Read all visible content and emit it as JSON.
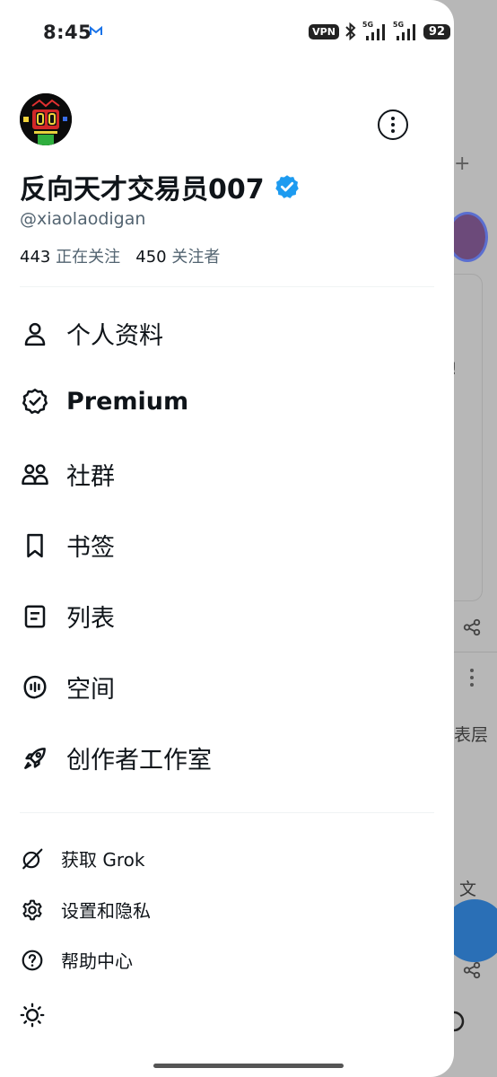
{
  "status_bar": {
    "time": "8:45",
    "vpn": "VPN",
    "signal_1": "5G",
    "signal_2": "5G",
    "battery": "92"
  },
  "profile": {
    "display_name": "反向天才交易员007",
    "handle": "@xiaolaodigan",
    "following_count": "443",
    "following_label": "正在关注",
    "followers_count": "450",
    "followers_label": "关注者",
    "verified_color": "#1d9bf0"
  },
  "menu": {
    "items": [
      {
        "label": "个人资料",
        "icon": "person-icon"
      },
      {
        "label": "Premium",
        "icon": "verified-badge-icon"
      },
      {
        "label": "社群",
        "icon": "communities-icon"
      },
      {
        "label": "书签",
        "icon": "bookmark-icon"
      },
      {
        "label": "列表",
        "icon": "list-icon"
      },
      {
        "label": "空间",
        "icon": "spaces-mic-icon"
      },
      {
        "label": "创作者工作室",
        "icon": "rocket-icon"
      }
    ]
  },
  "secondary": {
    "items": [
      {
        "label": "获取 Grok",
        "icon": "grok-icon"
      },
      {
        "label": "设置和隐私",
        "icon": "gear-icon"
      },
      {
        "label": "帮助中心",
        "icon": "help-icon"
      }
    ],
    "theme_toggle_icon": "sun-icon"
  },
  "background": {
    "fragment_1": "!",
    "fragment_2": "表层",
    "fragment_3": "文"
  }
}
